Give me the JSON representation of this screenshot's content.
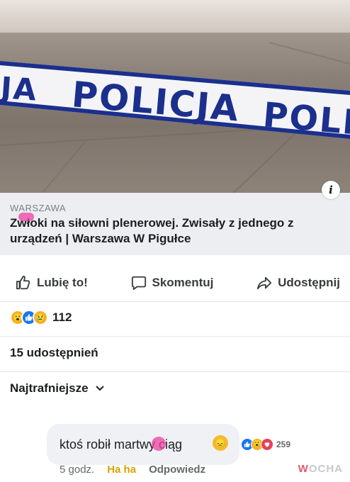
{
  "post": {
    "link_source": "WARSZAWA",
    "link_title": "Zwłoki na siłowni plenerowej. Zwisały z jednego z urządzeń | Warszawa W Pigułce",
    "tape_text_left": "JA",
    "tape_text_main": "POLICJA",
    "tape_text_right": "POLI",
    "info_icon": "i"
  },
  "actions": {
    "like_label": "Lubię to!",
    "comment_label": "Skomentuj",
    "share_label": "Udostępnij"
  },
  "reactions": {
    "count": "112",
    "icons": [
      "wow-icon",
      "like-icon",
      "sad-icon"
    ]
  },
  "shares": {
    "label": "15 udostępnień"
  },
  "sort": {
    "label": "Najtrafniejsze"
  },
  "comment": {
    "text": "ktoś robił martwy ciąg",
    "reaction_count": "259",
    "time": "5 godz.",
    "haha_label": "Ha ha",
    "reply_label": "Odpowiedz"
  },
  "watermark": {
    "mark": "W",
    "text": "OCHA"
  },
  "colors": {
    "tape_blue": "#1b2f8c",
    "link_bg": "#eceef1",
    "haha_yellow": "#d9a400",
    "like_blue": "#1877f2"
  }
}
